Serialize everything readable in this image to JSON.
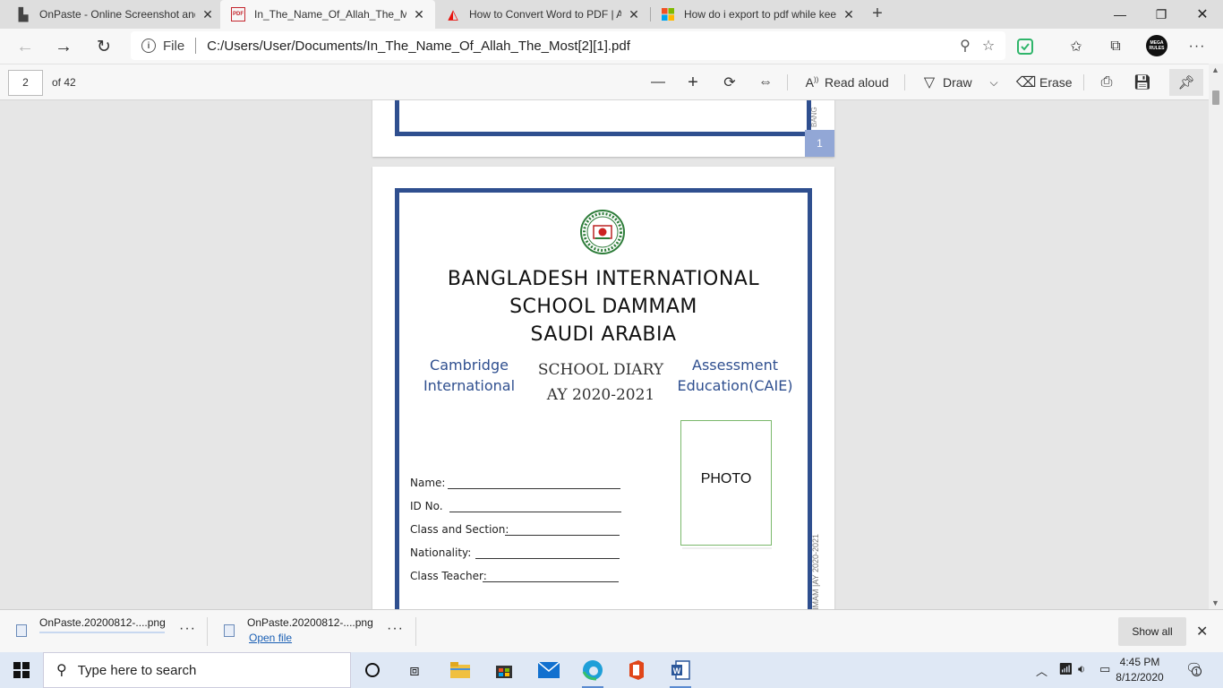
{
  "tabs": [
    {
      "title": "OnPaste - Online Screenshot and",
      "favicon": "onpaste-icon",
      "fav_glyph": "▙",
      "fav_color": "#444"
    },
    {
      "title": "In_The_Name_Of_Allah_The_Mos",
      "favicon": "pdf-icon",
      "fav_glyph": "PDF",
      "fav_color": "#c4262e"
    },
    {
      "title": "How to Convert Word to PDF | A",
      "favicon": "adobe-icon",
      "fav_glyph": "◭",
      "fav_color": "#e8120c"
    },
    {
      "title": "How do i export to pdf while kee",
      "favicon": "microsoft-icon",
      "fav_glyph": "▦",
      "fav_color": "#f25022"
    }
  ],
  "address": {
    "scheme_label": "File",
    "url": "C:/Users/User/Documents/In_The_Name_Of_Allah_The_Most[2][1].pdf"
  },
  "profile": {
    "avatar_text": "MEGA RULES"
  },
  "pdf_toolbar": {
    "page_number": "2",
    "page_total": "of 42",
    "read_aloud": "Read aloud",
    "draw": "Draw",
    "erase": "Erase"
  },
  "document": {
    "prev_page_number": "1",
    "prev_side_text": "BANG",
    "school_name": [
      "BANGLADESH INTERNATIONAL",
      "SCHOOL DAMMAM",
      "SAUDI ARABIA"
    ],
    "left_heading": [
      "Cambridge",
      "International"
    ],
    "right_heading": [
      "Assessment",
      "Education(CAIE)"
    ],
    "diary_title": [
      "SCHOOL DIARY",
      "AY 2020-2021"
    ],
    "photo_label": "PHOTO",
    "side_text": "MMAM |AY 2020-2021",
    "fields": [
      "Name:",
      "ID No.",
      "Class and Section:",
      "Nationality:",
      "Class Teacher:"
    ]
  },
  "downloads": {
    "items": [
      {
        "filename": "OnPaste.20200812-....png",
        "action": ""
      },
      {
        "filename": "OnPaste.20200812-....png",
        "action": "Open file"
      }
    ],
    "show_all": "Show all"
  },
  "taskbar": {
    "search_placeholder": "Type here to search",
    "time": "4:45 PM",
    "date": "8/12/2020",
    "notification_count": "1"
  },
  "colors": {
    "frame_blue": "#2f4f8f",
    "caie_blue": "#2f4f8f",
    "photo_border": "#7ab86b",
    "page_badge": "#92a7d6"
  }
}
